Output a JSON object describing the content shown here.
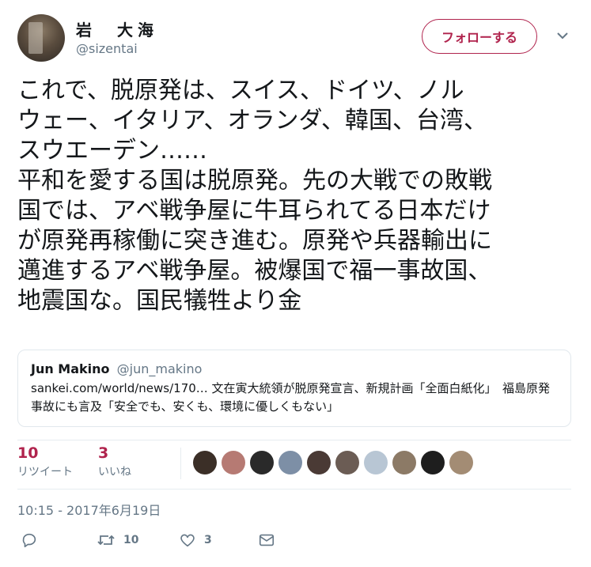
{
  "tweet": {
    "display_name": "岩　大海",
    "handle": "@sizentai",
    "follow_label": "フォローする",
    "text": "これで、脱原発は、スイス、ドイツ、ノル\nウェー、イタリア、オランダ、韓国、台湾、\nスウエーデン……\n平和を愛する国は脱原発。先の大戦での敗戦\n国では、アベ戦争屋に牛耳られてる日本だけ\nが原発再稼働に突き進む。原発や兵器輸出に\n邁進するアベ戦争屋。被爆国で福一事故国、\n地震国な。国民犠牲より金",
    "quoted": {
      "name": "Jun Makino",
      "handle": "@jun_makino",
      "text": "sankei.com/world/news/170… 文在寅大統領が脱原発宣言、新規計画「全面白紙化」　福島原発事故にも言及「安全でも、安くも、環境に優しくもない」"
    },
    "stats": {
      "retweets_count": "10",
      "retweets_label": "リツイート",
      "likes_count": "3",
      "likes_label": "いいね"
    },
    "timestamp": "10:15 - 2017年6月19日",
    "actions": {
      "retweet_count": "10",
      "like_count": "3"
    }
  },
  "colors": {
    "accent": "#b0234d",
    "secondary_text": "#657786",
    "border": "#e1e8ed"
  },
  "icons": [
    "chevron-down-icon",
    "reply-icon",
    "retweet-icon",
    "heart-icon",
    "mail-icon"
  ]
}
